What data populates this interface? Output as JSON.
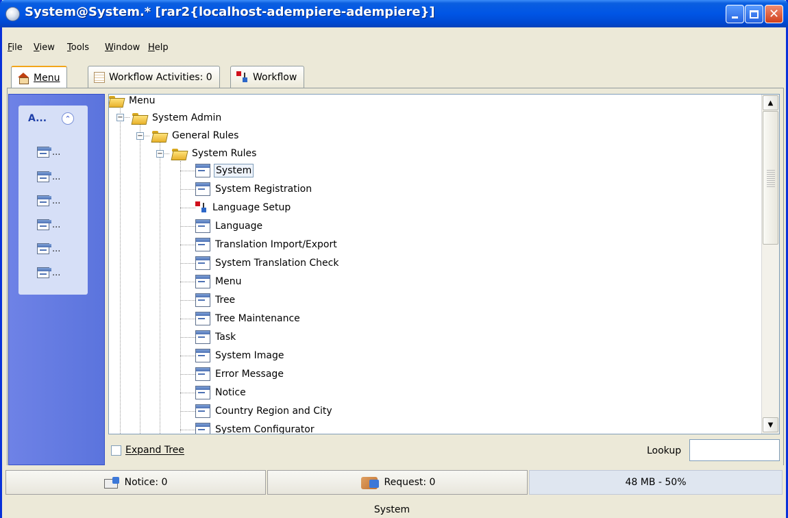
{
  "window": {
    "title": "System@System.* [rar2{localhost-adempiere-adempiere}]",
    "close_glyph": "✕"
  },
  "menubar": {
    "items": [
      "File",
      "View",
      "Tools",
      "Window",
      "Help"
    ]
  },
  "tabs": [
    {
      "label": "Menu",
      "icon": "home-icon",
      "active": true
    },
    {
      "label": "Workflow Activities: 0",
      "icon": "list-icon",
      "active": false
    },
    {
      "label": "Workflow",
      "icon": "workflow-icon",
      "active": false
    }
  ],
  "sidebar": {
    "header": "A...",
    "collapse_glyph": "⌃",
    "items": [
      "...",
      "...",
      "...",
      "...",
      "...",
      "..."
    ]
  },
  "tree": {
    "root": "Menu",
    "system_admin": "System Admin",
    "general_rules": "General Rules",
    "system_rules": "System Rules",
    "expander_glyph": "−",
    "items": [
      {
        "label": "System",
        "icon": "window-icon",
        "selected": true
      },
      {
        "label": "System Registration",
        "icon": "window-icon"
      },
      {
        "label": "Language Setup",
        "icon": "workflow-icon"
      },
      {
        "label": "Language",
        "icon": "window-icon"
      },
      {
        "label": "Translation Import/Export",
        "icon": "window-icon"
      },
      {
        "label": "System Translation Check",
        "icon": "window-icon"
      },
      {
        "label": "Menu",
        "icon": "window-icon"
      },
      {
        "label": "Tree",
        "icon": "window-icon"
      },
      {
        "label": "Tree Maintenance",
        "icon": "window-icon"
      },
      {
        "label": "Task",
        "icon": "window-icon"
      },
      {
        "label": "System Image",
        "icon": "window-icon"
      },
      {
        "label": "Error Message",
        "icon": "window-icon"
      },
      {
        "label": "Notice",
        "icon": "window-icon"
      },
      {
        "label": "Country Region and City",
        "icon": "window-icon"
      },
      {
        "label": "System Configurator",
        "icon": "window-icon"
      }
    ],
    "scroll_up_glyph": "▲",
    "scroll_down_glyph": "▼"
  },
  "bottom": {
    "expand_tree_label": "Expand Tree",
    "expand_tree_checked": false,
    "lookup_label": "Lookup",
    "lookup_value": ""
  },
  "status": {
    "notice": "Notice: 0",
    "request": "Request: 0",
    "memory": "48 MB - 50%"
  },
  "footer": {
    "text": "System"
  }
}
